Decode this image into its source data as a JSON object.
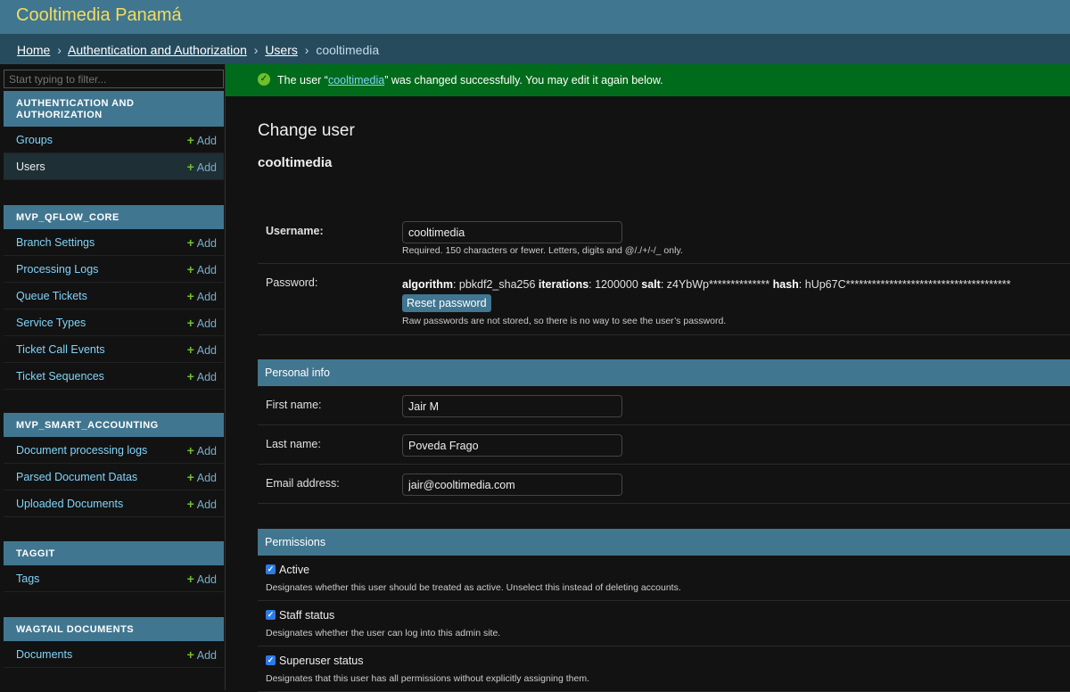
{
  "header": {
    "site_name": "Cooltimedia Panamá"
  },
  "breadcrumbs": {
    "home": "Home",
    "app": "Authentication and Authorization",
    "model": "Users",
    "current": "cooltimedia",
    "sep": "›"
  },
  "sidebar": {
    "filter_placeholder": "Start typing to filter...",
    "add_label": "Add",
    "modules": [
      {
        "caption_line1": "AUTHENTICATION AND",
        "caption_line2": "AUTHORIZATION",
        "models": [
          "Groups",
          "Users"
        ]
      },
      {
        "caption": "MVP_QFLOW_CORE",
        "models": [
          "Branch Settings",
          "Processing Logs",
          "Queue Tickets",
          "Service Types",
          "Ticket Call Events",
          "Ticket Sequences"
        ]
      },
      {
        "caption": "MVP_SMART_ACCOUNTING",
        "models": [
          "Document processing logs",
          "Parsed Document Datas",
          "Uploaded Documents"
        ]
      },
      {
        "caption": "TAGGIT",
        "models": [
          "Tags"
        ]
      },
      {
        "caption": "WAGTAIL DOCUMENTS",
        "models": [
          "Documents"
        ]
      }
    ]
  },
  "message": {
    "before": "The user “",
    "link": "cooltimedia",
    "after": "” was changed successfully. You may edit it again below."
  },
  "content": {
    "title": "Change user",
    "subtitle": "cooltimedia",
    "username": {
      "label": "Username:",
      "value": "cooltimedia",
      "help": "Required. 150 characters or fewer. Letters, digits and @/./+/-/_ only."
    },
    "password": {
      "label": "Password:",
      "algorithm_key": "algorithm",
      "algorithm_val": "pbkdf2_sha256",
      "iterations_key": "iterations",
      "iterations_val": "1200000",
      "salt_key": "salt",
      "salt_val": "z4YbWp**************",
      "hash_key": "hash",
      "hash_val": "hUp67C**************************************",
      "reset_label": "Reset password",
      "help": "Raw passwords are not stored, so there is no way to see the user’s password."
    },
    "personal_info": {
      "heading": "Personal info",
      "first_name": {
        "label": "First name:",
        "value": "Jair M"
      },
      "last_name": {
        "label": "Last name:",
        "value": "Poveda Frago"
      },
      "email": {
        "label": "Email address:",
        "value": "jair@cooltimedia.com"
      }
    },
    "permissions": {
      "heading": "Permissions",
      "active": {
        "label": "Active",
        "checked": true,
        "help": "Designates whether this user should be treated as active. Unselect this instead of deleting accounts."
      },
      "staff": {
        "label": "Staff status",
        "checked": true,
        "help": "Designates whether the user can log into this admin site."
      },
      "superuser": {
        "label": "Superuser status",
        "checked": true,
        "help": "Designates that this user has all permissions without explicitly assigning them."
      }
    }
  },
  "colors": {
    "header": "#417690",
    "breadcrumbs": "#264b5d",
    "site_name": "#f5dd5d",
    "success": "#006b1b",
    "add_plus": "#70bf2b",
    "link": "#81d4fa"
  }
}
